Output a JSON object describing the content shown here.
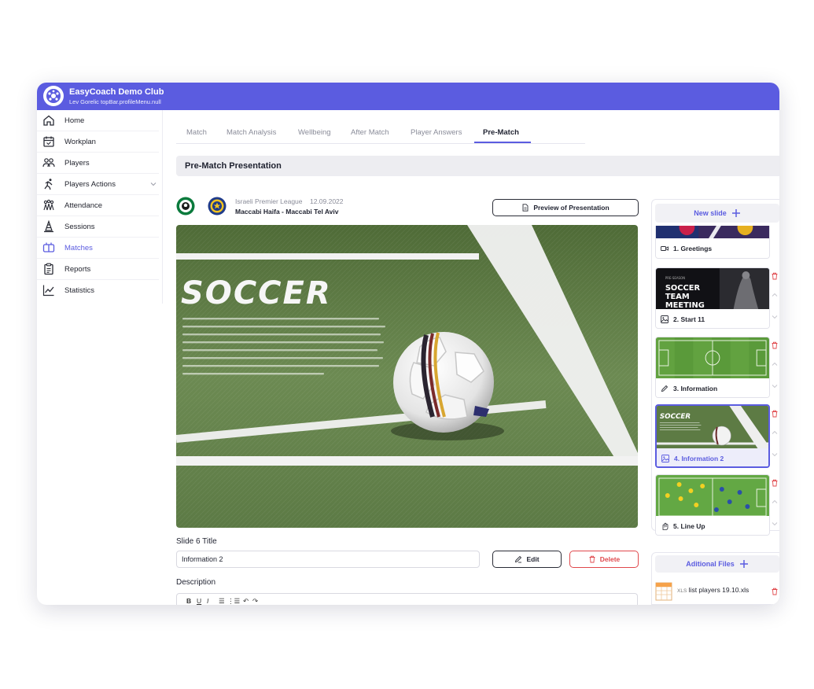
{
  "app": {
    "club_name": "EasyCoach Demo Club",
    "user_line": "Lev Gorelic topBar.profileMenu.null"
  },
  "sidebar": {
    "items": [
      {
        "label": "Home",
        "icon": "home-icon"
      },
      {
        "label": "Workplan",
        "icon": "calendar-icon"
      },
      {
        "label": "Players",
        "icon": "users-icon"
      },
      {
        "label": "Players Actions",
        "icon": "running-icon",
        "expandable": true
      },
      {
        "label": "Attendance",
        "icon": "group-icon"
      },
      {
        "label": "Sessions",
        "icon": "cone-icon"
      },
      {
        "label": "Matches",
        "icon": "scoreboard-icon",
        "active": true
      },
      {
        "label": "Reports",
        "icon": "clipboard-icon"
      },
      {
        "label": "Statistics",
        "icon": "chart-line-icon"
      }
    ]
  },
  "tabs": [
    {
      "label": "Match"
    },
    {
      "label": "Match Analysis"
    },
    {
      "label": "Wellbeing"
    },
    {
      "label": "After Match"
    },
    {
      "label": "Player Answers"
    },
    {
      "label": "Pre-Match",
      "active": true
    }
  ],
  "section": {
    "title": "Pre-Match Presentation"
  },
  "match": {
    "league": "Israeli Premier League",
    "date": "12.09.2022",
    "teams": "Maccabi Haifa - Maccabi Tel Aviv"
  },
  "buttons": {
    "preview": "Preview of Presentation",
    "edit": "Edit",
    "delete": "Delete",
    "new_slide": "New slide",
    "additional_files": "Aditional Files"
  },
  "slide_preview": {
    "heading": "SOCCER"
  },
  "form": {
    "title_label": "Slide 6 Title",
    "title_value": "Information 2",
    "description_label": "Description",
    "toolbar": [
      "B",
      "U",
      "I",
      "☰",
      "⋮☰",
      "↶",
      "↷"
    ]
  },
  "slides": [
    {
      "label": "1. Greetings",
      "icon": "video-icon"
    },
    {
      "label": "2. Start 11",
      "icon": "image-icon",
      "thumb_text": "SOCCER TEAM MEETING",
      "thumb_small": "PRE-SEASON"
    },
    {
      "label": "3. Information",
      "icon": "pencil-icon"
    },
    {
      "label": "4. Information 2",
      "icon": "image-icon",
      "selected": true,
      "thumb_text": "SOCCER"
    },
    {
      "label": "5. Line Up",
      "icon": "hand-icon"
    }
  ],
  "files": [
    {
      "name": "list players 19.10.xls",
      "type": "XLS"
    }
  ],
  "colors": {
    "accent": "#5b5ce0",
    "danger": "#e0484c",
    "grass": "#5c7a3e"
  }
}
